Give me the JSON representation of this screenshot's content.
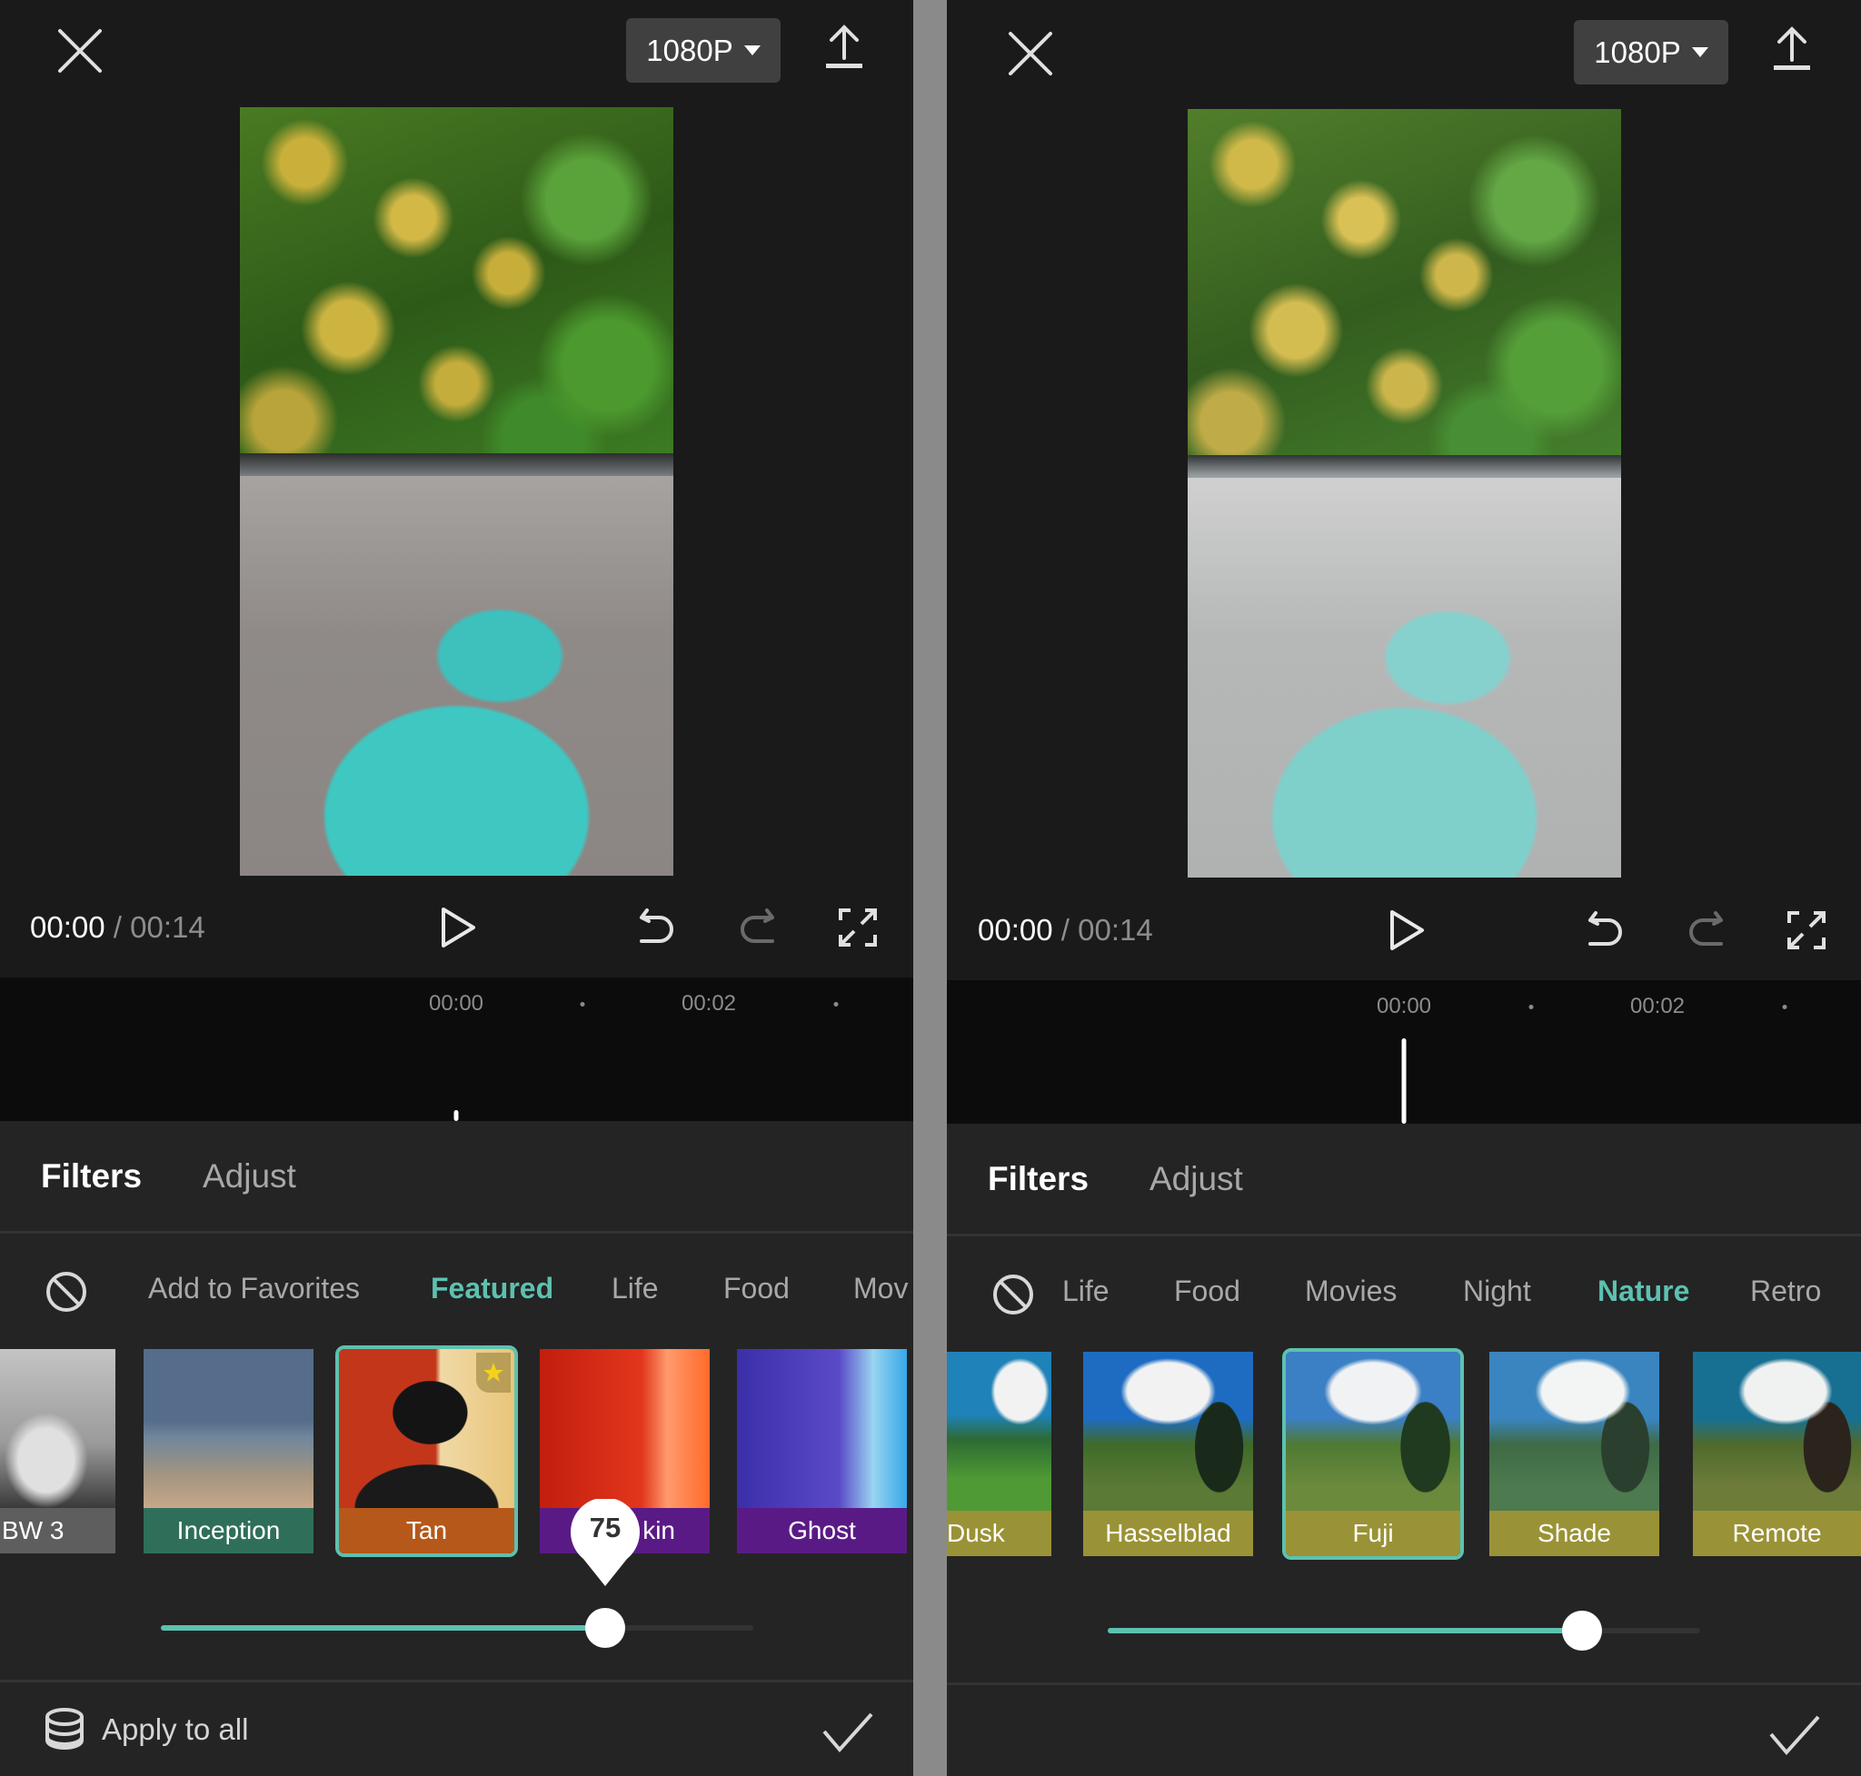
{
  "colors": {
    "accent": "#5dc1b0",
    "background": "#1a1a1a",
    "sheet": "#242424",
    "timeline": "#0c0c0c",
    "divider": "#8a8a8a"
  },
  "left": {
    "top_bar": {
      "close_icon": "close-icon",
      "resolution": "1080P",
      "export_icon": "upload-icon"
    },
    "playback": {
      "current_time": "00:00",
      "separator": "/",
      "total_time": "00:14"
    },
    "timeline": {
      "ticks": [
        "00:00",
        "00:02"
      ]
    },
    "tabs": [
      {
        "label": "Filters",
        "active": true
      },
      {
        "label": "Adjust",
        "active": false
      }
    ],
    "categories": [
      {
        "label": "Add to Favorites",
        "active": false
      },
      {
        "label": "Featured",
        "active": true
      },
      {
        "label": "Life",
        "active": false
      },
      {
        "label": "Food",
        "active": false
      },
      {
        "label": "Mov",
        "active": false
      }
    ],
    "filters": [
      {
        "label": "BW 3",
        "label_color": "#5e5e5e",
        "selected": false
      },
      {
        "label": "Inception",
        "label_color": "#2f6f5a",
        "selected": false
      },
      {
        "label": "Tan",
        "label_color": "#b6581a",
        "selected": true,
        "favorite": true
      },
      {
        "label": "kin",
        "label_color": "#5a1a86",
        "selected": false
      },
      {
        "label": "Ghost",
        "label_color": "#5a1a86",
        "selected": false
      }
    ],
    "intensity": {
      "value": 75,
      "max": 100,
      "tooltip": "75"
    },
    "apply_to_all": "Apply to all"
  },
  "right": {
    "top_bar": {
      "close_icon": "close-icon",
      "resolution": "1080P",
      "export_icon": "upload-icon"
    },
    "playback": {
      "current_time": "00:00",
      "separator": "/",
      "total_time": "00:14"
    },
    "timeline": {
      "ticks": [
        "00:00",
        "00:02"
      ]
    },
    "tabs": [
      {
        "label": "Filters",
        "active": true
      },
      {
        "label": "Adjust",
        "active": false
      }
    ],
    "categories": [
      {
        "label": "Life",
        "active": false
      },
      {
        "label": "Food",
        "active": false
      },
      {
        "label": "Movies",
        "active": false
      },
      {
        "label": "Night",
        "active": false
      },
      {
        "label": "Nature",
        "active": true
      },
      {
        "label": "Retro",
        "active": false
      }
    ],
    "filters": [
      {
        "label": "Dusk",
        "label_color": "#9a9236",
        "selected": false
      },
      {
        "label": "Hasselblad",
        "label_color": "#9a9236",
        "selected": false
      },
      {
        "label": "Fuji",
        "label_color": "#9a9236",
        "selected": true
      },
      {
        "label": "Shade",
        "label_color": "#9a9236",
        "selected": false
      },
      {
        "label": "Remote",
        "label_color": "#9a9236",
        "selected": false
      }
    ],
    "intensity": {
      "value": 80,
      "max": 100
    }
  }
}
